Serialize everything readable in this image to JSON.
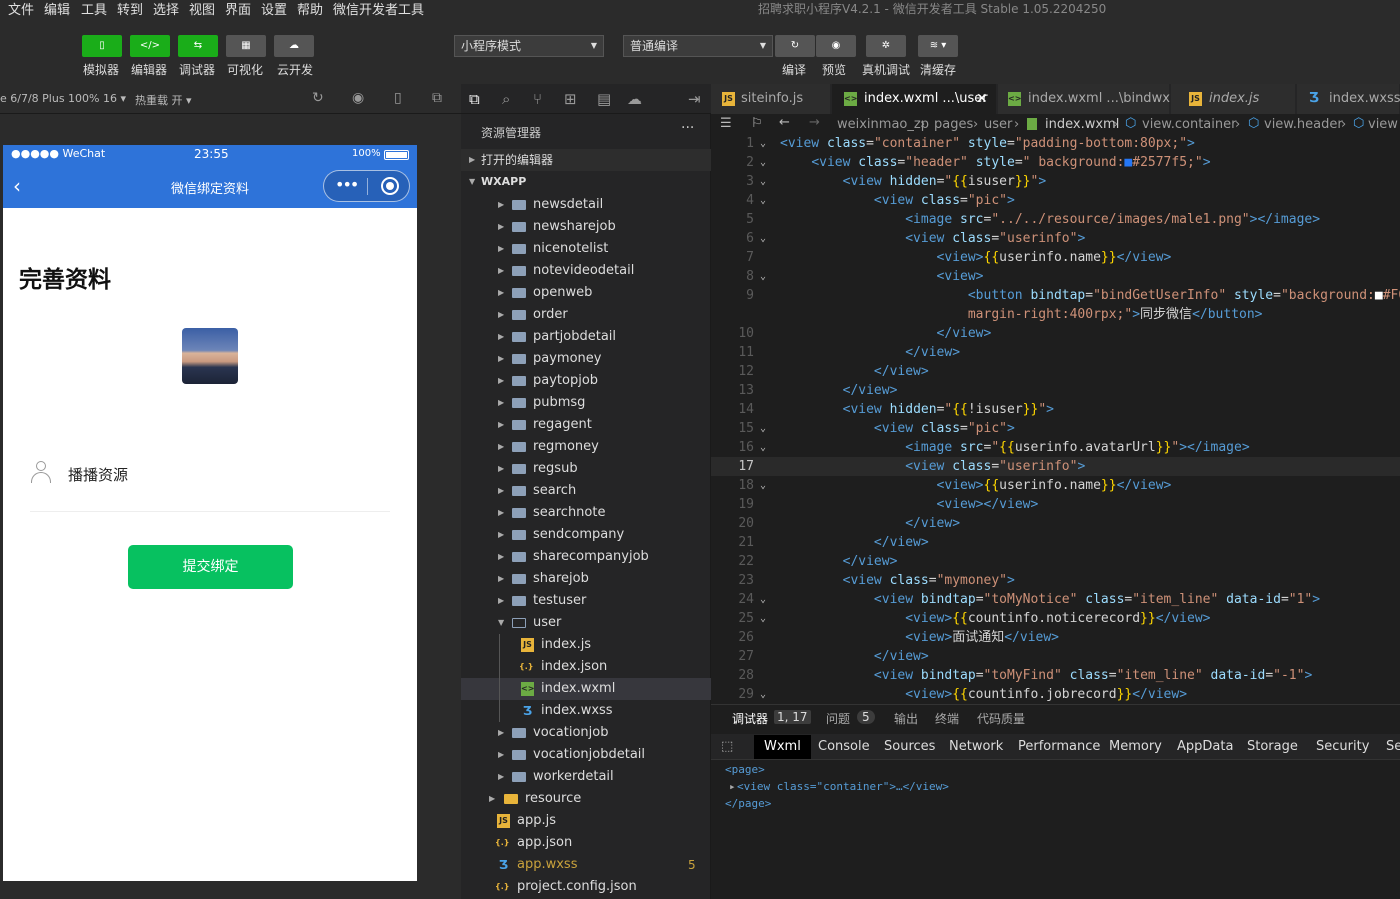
{
  "menubar": {
    "items": [
      "文件",
      "编辑",
      "工具",
      "转到",
      "选择",
      "视图",
      "界面",
      "设置",
      "帮助",
      "微信开发者工具"
    ],
    "window_title": "招聘求职小程序V4.2.1 - 微信开发者工具 Stable 1.05.2204250"
  },
  "toolbar": {
    "buttons": [
      {
        "label": "模拟器",
        "icon": "phone-icon"
      },
      {
        "label": "编辑器",
        "icon": "code-icon"
      },
      {
        "label": "调试器",
        "icon": "debug-icon"
      },
      {
        "label": "可视化",
        "icon": "layout-icon"
      },
      {
        "label": "云开发",
        "icon": "cloud-icon"
      }
    ],
    "mode_select": "小程序模式",
    "compile_select": "普通编译",
    "actions": [
      "编译",
      "预览",
      "真机调试",
      "清缓存"
    ]
  },
  "simulator": {
    "device": "e 6/7/8 Plus 100% 16",
    "hot_reload": "热重载 开",
    "status_carrier": "●●●●● WeChat",
    "status_time": "23:55",
    "status_battery": "100%",
    "nav_title": "微信绑定资料",
    "page_heading": "完善资料",
    "username": "播播资源",
    "submit_label": "提交绑定",
    "colors": {
      "nav": "#2e73d9",
      "button": "#07c160"
    }
  },
  "explorer": {
    "title": "资源管理器",
    "open_editors": "打开的编辑器",
    "root": "WXAPP",
    "folders": [
      "newsdetail",
      "newsharejob",
      "nicenotelist",
      "notevideodetail",
      "openweb",
      "order",
      "partjobdetail",
      "paymoney",
      "paytopjob",
      "pubmsg",
      "regagent",
      "regmoney",
      "regsub",
      "search",
      "searchnote",
      "sendcompany",
      "sharecompanyjob",
      "sharejob",
      "testuser"
    ],
    "user_folder": "user",
    "user_files": [
      "index.js",
      "index.json",
      "index.wxml",
      "index.wxss"
    ],
    "folders_after": [
      "vocationjob",
      "vocationjobdetail",
      "workerdetail"
    ],
    "resource": "resource",
    "root_files": [
      "app.js",
      "app.json",
      "app.wxss",
      "project.config.json"
    ],
    "wxss_badge": "5"
  },
  "editor": {
    "tabs": [
      "siteinfo.js",
      "index.wxml ...\\user",
      "index.wxml ...\\bindwx",
      "index.js",
      "index.wxss"
    ],
    "breadcrumb": [
      "weixinmao_zp",
      "pages",
      "user",
      "index.wxml",
      "view.container",
      "view.header",
      "view"
    ],
    "line_numbers": [
      "1",
      "2",
      "3",
      "4",
      "5",
      "6",
      "7",
      "8",
      "9",
      "",
      "10",
      "11",
      "12",
      "13",
      "14",
      "15",
      "16",
      "17",
      "18",
      "19",
      "20",
      "21",
      "22",
      "23",
      "24",
      "25",
      "26",
      "27",
      "28",
      "29"
    ],
    "lines": [
      [
        [
          "t",
          "<view "
        ],
        [
          "a",
          "class"
        ],
        [
          "p",
          "="
        ],
        [
          "s",
          "\"container\""
        ],
        [
          "p",
          " "
        ],
        [
          "a",
          "style"
        ],
        [
          "p",
          "="
        ],
        [
          "s",
          "\"padding-bottom:80px;\""
        ],
        [
          "t",
          ">"
        ]
      ],
      [
        [
          "p",
          "    "
        ],
        [
          "t",
          "<view "
        ],
        [
          "a",
          "class"
        ],
        [
          "p",
          "="
        ],
        [
          "s",
          "\"header\""
        ],
        [
          "p",
          " "
        ],
        [
          "a",
          "style"
        ],
        [
          "p",
          "="
        ],
        [
          "s",
          "\" background:"
        ],
        [
          "p",
          "■"
        ],
        [
          "s",
          "#2577f5;\""
        ],
        [
          "t",
          ">"
        ]
      ],
      [
        [
          "p",
          "        "
        ],
        [
          "t",
          "<view "
        ],
        [
          "a",
          "hidden"
        ],
        [
          "p",
          "="
        ],
        [
          "s",
          "\""
        ],
        [
          "b",
          "{{"
        ],
        [
          "p",
          "isuser"
        ],
        [
          "b",
          "}}"
        ],
        [
          "s",
          "\""
        ],
        [
          "t",
          ">"
        ]
      ],
      [
        [
          "p",
          "            "
        ],
        [
          "t",
          "<view "
        ],
        [
          "a",
          "class"
        ],
        [
          "p",
          "="
        ],
        [
          "s",
          "\"pic\""
        ],
        [
          "t",
          ">"
        ]
      ],
      [
        [
          "p",
          "                "
        ],
        [
          "t",
          "<image "
        ],
        [
          "a",
          "src"
        ],
        [
          "p",
          "="
        ],
        [
          "s",
          "\"../../resource/images/male1.png\""
        ],
        [
          "t",
          "></image>"
        ]
      ],
      [
        [
          "p",
          "                "
        ],
        [
          "t",
          "<view "
        ],
        [
          "a",
          "class"
        ],
        [
          "p",
          "="
        ],
        [
          "s",
          "\"userinfo\""
        ],
        [
          "t",
          ">"
        ]
      ],
      [
        [
          "p",
          "                    "
        ],
        [
          "t",
          "<view>"
        ],
        [
          "b",
          "{{"
        ],
        [
          "p",
          "userinfo.name"
        ],
        [
          "b",
          "}}"
        ],
        [
          "t",
          "</view>"
        ]
      ],
      [
        [
          "p",
          "                    "
        ],
        [
          "t",
          "<view>"
        ]
      ],
      [
        [
          "p",
          "                        "
        ],
        [
          "t",
          "<button "
        ],
        [
          "a",
          "bindtap"
        ],
        [
          "p",
          "="
        ],
        [
          "s",
          "\"bindGetUserInfo\""
        ],
        [
          "p",
          " "
        ],
        [
          "a",
          "style"
        ],
        [
          "p",
          "="
        ],
        [
          "s",
          "\"background:"
        ],
        [
          "p",
          "■"
        ],
        [
          "s",
          "#F0"
        ]
      ],
      [
        [
          "p",
          "                        "
        ],
        [
          "s",
          "margin-right:400rpx;\""
        ],
        [
          "t",
          ">"
        ],
        [
          "p",
          "同步微信"
        ],
        [
          "t",
          "</button>"
        ]
      ],
      [
        [
          "p",
          "                    "
        ],
        [
          "t",
          "</view>"
        ]
      ],
      [
        [
          "p",
          "                "
        ],
        [
          "t",
          "</view>"
        ]
      ],
      [
        [
          "p",
          "            "
        ],
        [
          "t",
          "</view>"
        ]
      ],
      [
        [
          "p",
          "        "
        ],
        [
          "t",
          "</view>"
        ]
      ],
      [
        [
          "p",
          "        "
        ],
        [
          "t",
          "<view "
        ],
        [
          "a",
          "hidden"
        ],
        [
          "p",
          "="
        ],
        [
          "s",
          "\""
        ],
        [
          "b",
          "{{"
        ],
        [
          "p",
          "!isuser"
        ],
        [
          "b",
          "}}"
        ],
        [
          "s",
          "\""
        ],
        [
          "t",
          ">"
        ]
      ],
      [
        [
          "p",
          "            "
        ],
        [
          "t",
          "<view "
        ],
        [
          "a",
          "class"
        ],
        [
          "p",
          "="
        ],
        [
          "s",
          "\"pic\""
        ],
        [
          "t",
          ">"
        ]
      ],
      [
        [
          "p",
          "                "
        ],
        [
          "t",
          "<image "
        ],
        [
          "a",
          "src"
        ],
        [
          "p",
          "="
        ],
        [
          "s",
          "\""
        ],
        [
          "b",
          "{{"
        ],
        [
          "p",
          "userinfo.avatarUrl"
        ],
        [
          "b",
          "}}"
        ],
        [
          "s",
          "\""
        ],
        [
          "t",
          "></image>"
        ]
      ],
      [
        [
          "p",
          "                "
        ],
        [
          "t",
          "<view "
        ],
        [
          "a",
          "class"
        ],
        [
          "p",
          "="
        ],
        [
          "s",
          "\"userinfo\""
        ],
        [
          "t",
          ">"
        ]
      ],
      [
        [
          "p",
          "                    "
        ],
        [
          "t",
          "<view>"
        ],
        [
          "b",
          "{{"
        ],
        [
          "p",
          "userinfo.name"
        ],
        [
          "b",
          "}}"
        ],
        [
          "t",
          "</view>"
        ]
      ],
      [
        [
          "p",
          "                    "
        ],
        [
          "t",
          "<view></view>"
        ]
      ],
      [
        [
          "p",
          "                "
        ],
        [
          "t",
          "</view>"
        ]
      ],
      [
        [
          "p",
          "            "
        ],
        [
          "t",
          "</view>"
        ]
      ],
      [
        [
          "p",
          "        "
        ],
        [
          "t",
          "</view>"
        ]
      ],
      [
        [
          "p",
          "        "
        ],
        [
          "t",
          "<view "
        ],
        [
          "a",
          "class"
        ],
        [
          "p",
          "="
        ],
        [
          "s",
          "\"mymoney\""
        ],
        [
          "t",
          ">"
        ]
      ],
      [
        [
          "p",
          "            "
        ],
        [
          "t",
          "<view "
        ],
        [
          "a",
          "bindtap"
        ],
        [
          "p",
          "="
        ],
        [
          "s",
          "\"toMyNotice\""
        ],
        [
          "p",
          " "
        ],
        [
          "a",
          "class"
        ],
        [
          "p",
          "="
        ],
        [
          "s",
          "\"item_line\""
        ],
        [
          "p",
          " "
        ],
        [
          "a",
          "data-id"
        ],
        [
          "p",
          "="
        ],
        [
          "s",
          "\"1\""
        ],
        [
          "t",
          ">"
        ]
      ],
      [
        [
          "p",
          "                "
        ],
        [
          "t",
          "<view>"
        ],
        [
          "b",
          "{{"
        ],
        [
          "p",
          "countinfo.noticerecord"
        ],
        [
          "b",
          "}}"
        ],
        [
          "t",
          "</view>"
        ]
      ],
      [
        [
          "p",
          "                "
        ],
        [
          "t",
          "<view>"
        ],
        [
          "p",
          "面试通知"
        ],
        [
          "t",
          "</view>"
        ]
      ],
      [
        [
          "p",
          "            "
        ],
        [
          "t",
          "</view>"
        ]
      ],
      [
        [
          "p",
          "            "
        ],
        [
          "t",
          "<view "
        ],
        [
          "a",
          "bindtap"
        ],
        [
          "p",
          "="
        ],
        [
          "s",
          "\"toMyFind\""
        ],
        [
          "p",
          " "
        ],
        [
          "a",
          "class"
        ],
        [
          "p",
          "="
        ],
        [
          "s",
          "\"item_line\""
        ],
        [
          "p",
          " "
        ],
        [
          "a",
          "data-id"
        ],
        [
          "p",
          "="
        ],
        [
          "s",
          "\"-1\""
        ],
        [
          "t",
          ">"
        ]
      ],
      [
        [
          "p",
          "                "
        ],
        [
          "t",
          "<view>"
        ],
        [
          "b",
          "{{"
        ],
        [
          "p",
          "countinfo.jobrecord"
        ],
        [
          "b",
          "}}"
        ],
        [
          "t",
          "</view>"
        ]
      ]
    ]
  },
  "debugger": {
    "tabs": [
      "调试器",
      "1, 17",
      "问题",
      "5",
      "输出",
      "终端",
      "代码质量"
    ],
    "devtools_tabs": [
      "Wxml",
      "Console",
      "Sources",
      "Network",
      "Performance",
      "Memory",
      "AppData",
      "Storage",
      "Security",
      "Se"
    ],
    "xml": [
      "<page>",
      "<view class=\"container\">…</view>",
      "</page>"
    ]
  }
}
